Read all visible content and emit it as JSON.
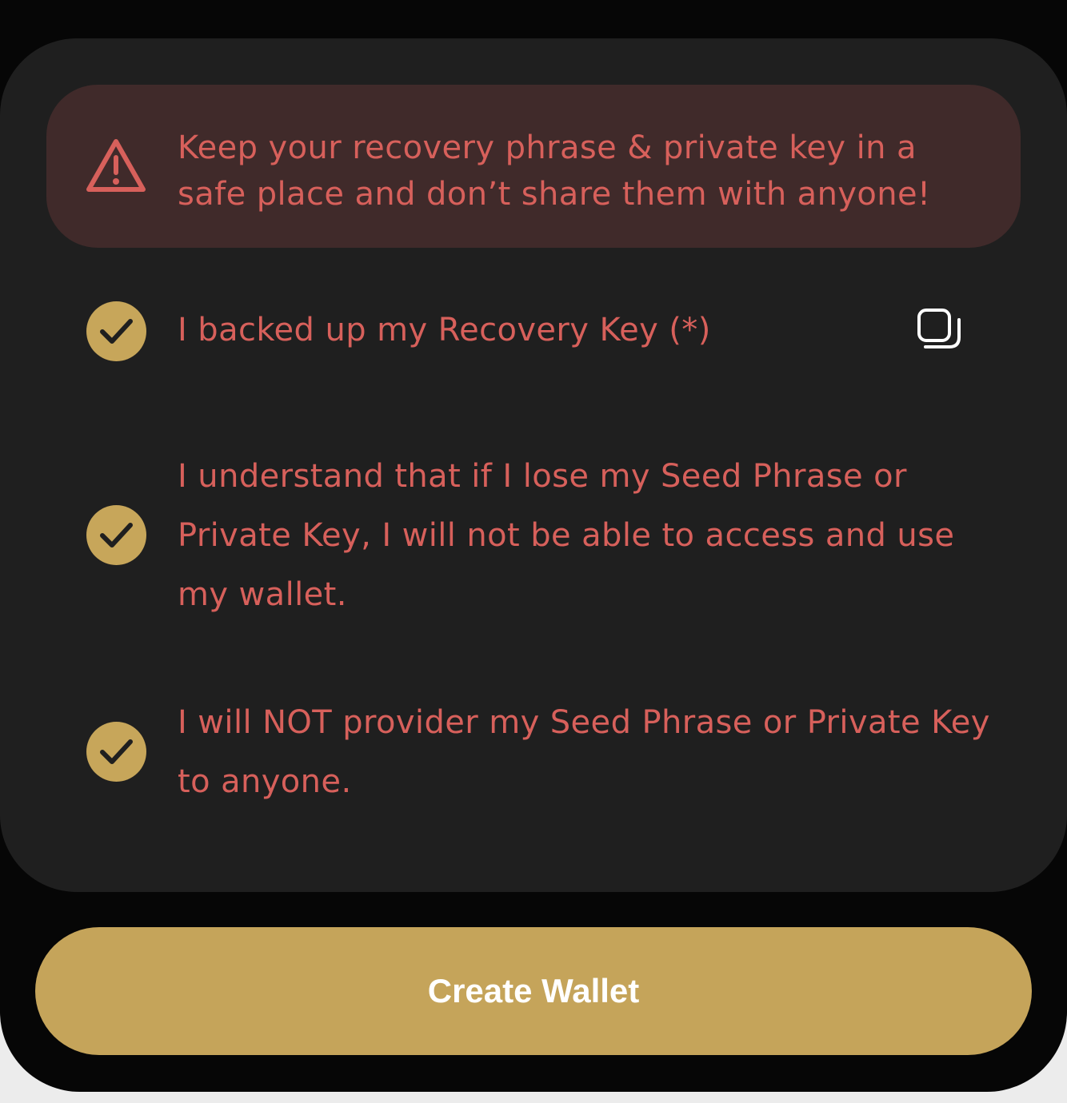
{
  "warning": {
    "icon": "warning-triangle-icon",
    "text": "Keep your recovery phrase & private key in a safe place and don’t share them with anyone!"
  },
  "checklist": [
    {
      "icon": "check-circle-icon",
      "label": "I backed up my Recovery Key (*)",
      "checked": true,
      "action_icon": "copy-icon"
    },
    {
      "icon": "check-circle-icon",
      "label": "I understand that if I lose my Seed Phrase or Private Key, I will not be able to access and use my wallet.",
      "checked": true
    },
    {
      "icon": "check-circle-icon",
      "label": "I will NOT provider my Seed Phrase or Private Key to anyone.",
      "checked": true
    }
  ],
  "primary_button": {
    "label": "Create Wallet"
  },
  "colors": {
    "background": "#060606",
    "card": "#1f1f1f",
    "warning_background": "#402a2a",
    "warning_text": "#d7605b",
    "accent": "#c7a65a",
    "button_text": "#ffffff"
  }
}
